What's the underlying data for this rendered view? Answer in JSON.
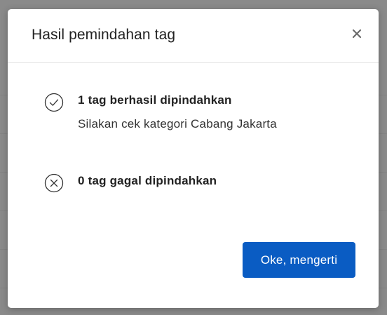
{
  "dialog": {
    "title": "Hasil pemindahan tag",
    "close_icon": "close-icon",
    "results": {
      "success": {
        "icon": "check-circle-icon",
        "message": "1 tag berhasil dipindahkan",
        "detail": "Silakan cek kategori Cabang Jakarta"
      },
      "failure": {
        "icon": "x-circle-icon",
        "message": "0 tag gagal dipindahkan"
      }
    },
    "confirm_label": "Oke, mengerti"
  },
  "colors": {
    "primary_button": "#0a5cc3",
    "overlay": "#8a8a8a",
    "text": "#222222"
  }
}
